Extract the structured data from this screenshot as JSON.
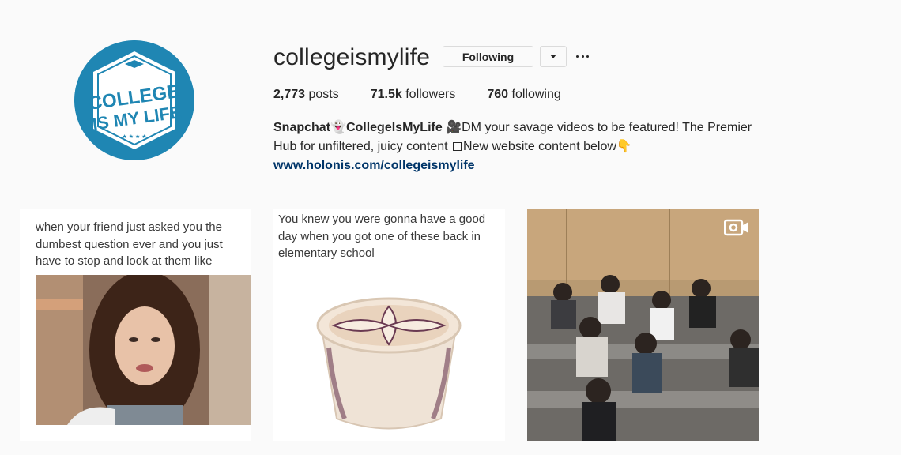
{
  "profile": {
    "username": "collegeismylife",
    "following_label": "Following",
    "avatar_text_line1": "COLLEGE",
    "avatar_text_line2": "IS MY LIFE"
  },
  "stats": {
    "posts_count": "2,773",
    "posts_label": " posts",
    "followers_count": "71.5k",
    "followers_label": " followers",
    "following_count": "760",
    "following_label": " following"
  },
  "bio": {
    "name": "Snapchat👻CollegeIsMyLife",
    "text_part1": " 🎥DM your savage videos to be featured! The Premier Hub for unfiltered, juicy content ",
    "text_part2": "New website content below👇",
    "link": "www.holonis.com/collegeismylife"
  },
  "posts": [
    {
      "caption": "when your friend just asked you the dumbest question ever and you just have to stop and look at them like",
      "type": "image"
    },
    {
      "caption": "You knew you were gonna have a good day when you got one of these back in elementary school",
      "type": "image"
    },
    {
      "caption": "",
      "type": "video"
    }
  ],
  "colors": {
    "brand_blue": "#1f86b3",
    "link_blue": "#003569",
    "text": "#262626",
    "border": "#dbdbdb"
  }
}
